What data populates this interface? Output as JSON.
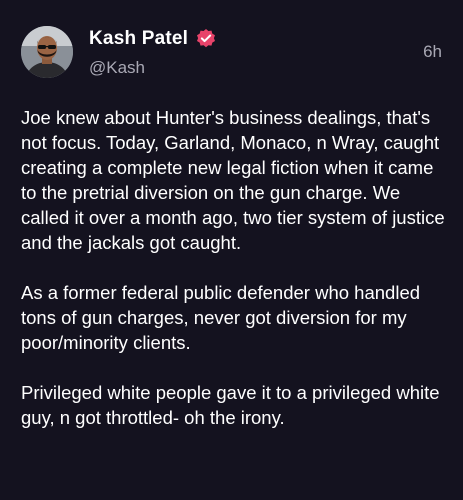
{
  "post": {
    "author": {
      "display_name": "Kash Patel",
      "handle": "@Kash",
      "avatar_icon": "profile-photo",
      "verified_icon": "verified-badge-icon",
      "verified_color": "#e8436a"
    },
    "timestamp": "6h",
    "paragraphs": [
      "Joe knew about Hunter's business dealings, that's not focus. Today, Garland, Monaco, n Wray, caught creating a complete new legal fiction when it came to the pretrial diversion on the gun charge. We called it over a month ago, two tier system of justice and the jackals got caught.",
      "As a former federal public defender who handled tons of gun charges, never got diversion for my poor/minority clients.",
      "Privileged white people gave it to a privileged white guy, n got throttled- oh the irony."
    ]
  },
  "theme": {
    "background": "#14121f",
    "text": "#ffffff",
    "muted": "#a9a8b4"
  }
}
